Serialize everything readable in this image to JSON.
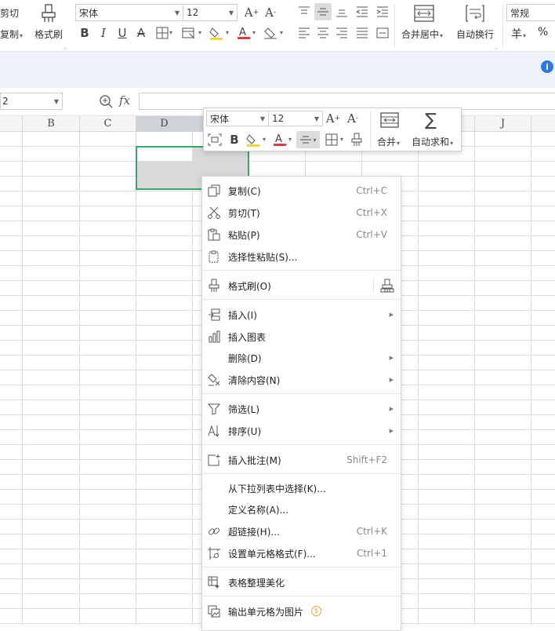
{
  "ribbon": {
    "cut_label": "剪切",
    "copy_label": "复制",
    "format_painter_label": "格式刷",
    "font_name": "宋体",
    "font_size": "12",
    "merge_center_label": "合并居中",
    "wrap_label": "自动换行",
    "number_format": "常规",
    "currency_symbol": "羊",
    "percent_symbol": "%"
  },
  "formula_bar": {
    "name_box": "2",
    "fx_label": "fx"
  },
  "columns": [
    "B",
    "C",
    "D",
    "J"
  ],
  "mini_toolbar": {
    "font_name": "宋体",
    "font_size": "12",
    "merge_label": "合并",
    "autosum_label": "自动求和"
  },
  "context_menu": {
    "copy": {
      "label": "复制(C)",
      "shortcut": "Ctrl+C"
    },
    "cut": {
      "label": "剪切(T)",
      "shortcut": "Ctrl+X"
    },
    "paste": {
      "label": "粘贴(P)",
      "shortcut": "Ctrl+V"
    },
    "paste_special": {
      "label": "选择性粘贴(S)..."
    },
    "format_painter": {
      "label": "格式刷(O)"
    },
    "insert": {
      "label": "插入(I)"
    },
    "insert_chart": {
      "label": "插入图表"
    },
    "delete": {
      "label": "删除(D)"
    },
    "clear": {
      "label": "清除内容(N)"
    },
    "filter": {
      "label": "筛选(L)"
    },
    "sort": {
      "label": "排序(U)"
    },
    "comment": {
      "label": "插入批注(M)",
      "shortcut": "Shift+F2"
    },
    "pick_list": {
      "label": "从下拉列表中选择(K)..."
    },
    "define_name": {
      "label": "定义名称(A)..."
    },
    "hyperlink": {
      "label": "超链接(H)...",
      "shortcut": "Ctrl+K"
    },
    "format_cells": {
      "label": "设置单元格格式(F)...",
      "shortcut": "Ctrl+1"
    },
    "beautify": {
      "label": "表格整理美化"
    },
    "export_image": {
      "label": "输出单元格为图片"
    }
  },
  "colors": {
    "accent_green": "#3aa56b",
    "font_red": "#e03a3a",
    "highlight_yellow": "#f5d33a",
    "info_blue": "#2b78e4",
    "premium_gold": "#f0a81e"
  }
}
